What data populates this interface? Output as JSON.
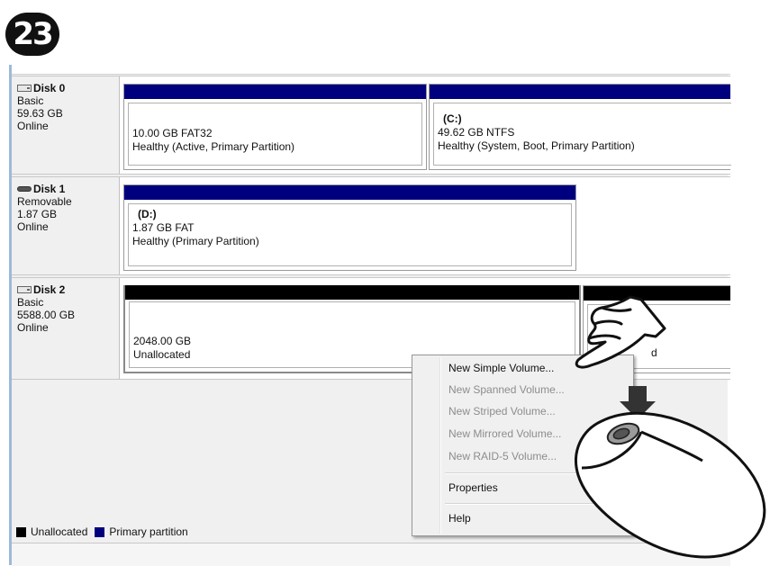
{
  "step": {
    "number": "23"
  },
  "disks": [
    {
      "name": "Disk 0",
      "type": "Basic",
      "size": "59.63 GB",
      "status": "Online",
      "partitions": [
        {
          "letter": "",
          "size": "10.00 GB FAT32",
          "status": "Healthy (Active, Primary Partition)"
        },
        {
          "letter": "(C:)",
          "size": "49.62 GB NTFS",
          "status": "Healthy (System, Boot, Primary Partition)"
        }
      ]
    },
    {
      "name": "Disk 1",
      "type": "Removable",
      "size": "1.87 GB",
      "status": "Online",
      "partitions": [
        {
          "letter": "(D:)",
          "size": "1.87 GB FAT",
          "status": "Healthy (Primary Partition)"
        }
      ]
    },
    {
      "name": "Disk 2",
      "type": "Basic",
      "size": "5588.00 GB",
      "status": "Online",
      "partitions": [
        {
          "size": "2048.00 GB",
          "status": "Unallocated"
        },
        {
          "size": "",
          "status": "d"
        }
      ]
    }
  ],
  "context_menu": {
    "items": [
      {
        "label": "New Simple Volume...",
        "enabled": true
      },
      {
        "label": "New Spanned Volume...",
        "enabled": false
      },
      {
        "label": "New Striped Volume...",
        "enabled": false
      },
      {
        "label": "New Mirrored Volume...",
        "enabled": false
      },
      {
        "label": "New RAID-5 Volume...",
        "enabled": false
      },
      {
        "label": "Properties",
        "enabled": true
      },
      {
        "label": "Help",
        "enabled": true
      }
    ]
  },
  "legend": [
    {
      "label": "Unallocated",
      "color": "#000000"
    },
    {
      "label": "Primary partition",
      "color": "#00007f"
    }
  ],
  "icons": {
    "disk_fixed": "hard-disk-icon",
    "disk_removable": "removable-disk-icon",
    "hand": "pointing-hand-icon",
    "mouse": "mouse-icon",
    "arrow": "down-arrow-icon"
  }
}
